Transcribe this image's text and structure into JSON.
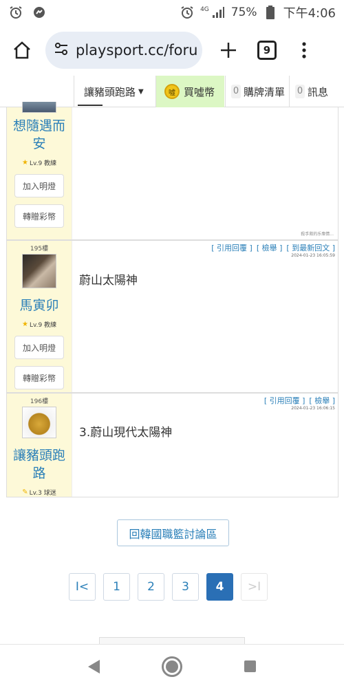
{
  "status_bar": {
    "alarm_icon": "alarm-clock-icon",
    "app_icon": "app-notification-icon",
    "network": "4G",
    "battery": "75%",
    "time": "下午4:06"
  },
  "browser": {
    "url": "playsport.cc/foru",
    "tab_count": "9"
  },
  "site_nav": {
    "user_label": "讓豬頭跑路",
    "coin_label": "買噓幣",
    "coin_icon_text": "噓",
    "cart_count": "0",
    "cart_label": "購牌清單",
    "msg_count": "0",
    "msg_label": "訊息"
  },
  "posts": [
    {
      "author": "想隨遇而安",
      "level": "Lv.9 教練",
      "add_btn": "加入明燈",
      "gift_btn": "轉贈彩幣",
      "body": "",
      "sig_note": "殺手救的乐衆情..."
    },
    {
      "floor": "195樓",
      "author": "馬寅卯",
      "level": "Lv.9 教練",
      "add_btn": "加入明燈",
      "gift_btn": "轉贈彩幣",
      "actions": [
        "[ 引用回覆 ]",
        "[ 檢舉 ]",
        "[ 到最新回文 ]"
      ],
      "time": "2024-01-23 16:05:59",
      "body": "蔚山太陽神"
    },
    {
      "floor": "196樓",
      "author": "讓豬頭跑路",
      "level": "Lv.3 球迷",
      "actions": [
        "[ 引用回覆 ]",
        "[ 檢舉 ]"
      ],
      "time": "2024-01-23 16:06:15",
      "body": "3.蔚山現代太陽神"
    }
  ],
  "back_button": "回韓國職籃討論區",
  "pagination": {
    "first": "I<",
    "pages": [
      "1",
      "2",
      "3",
      "4"
    ],
    "current": "4",
    "last": ">I"
  }
}
